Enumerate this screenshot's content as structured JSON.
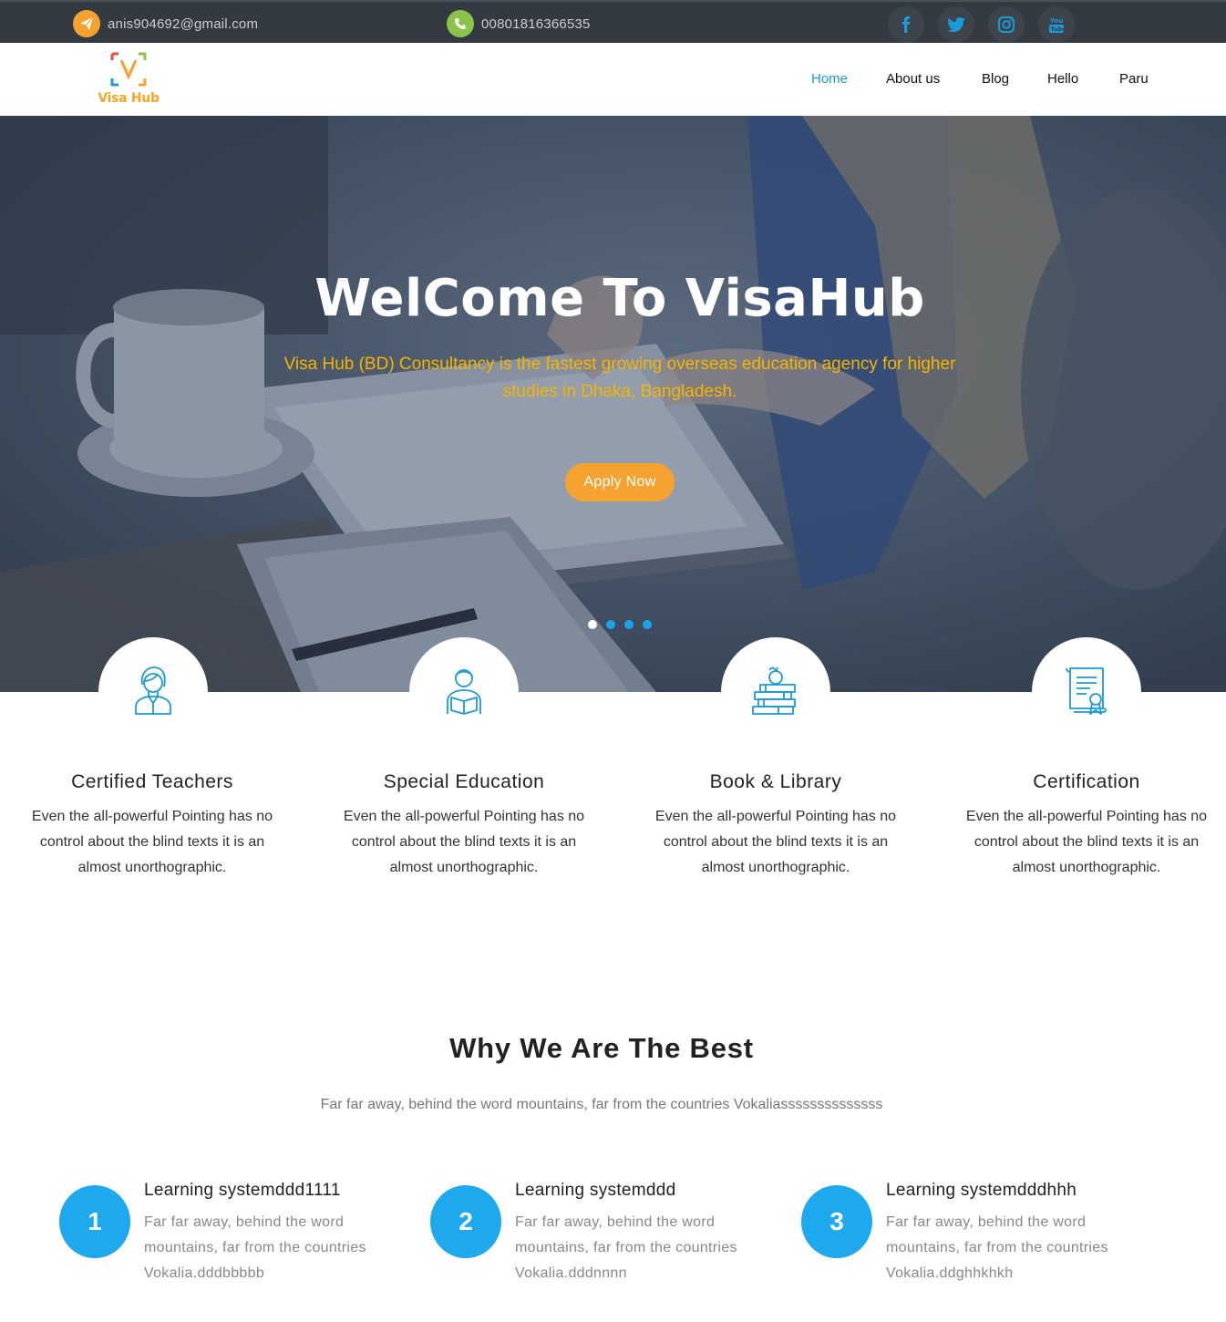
{
  "topbar": {
    "email": "anis904692@gmail.com",
    "phone": "00801816366535",
    "email_icon": "paper-plane-icon",
    "phone_icon": "phone-icon",
    "email_icon_color": "#f5a230",
    "phone_icon_color": "#8bc34a",
    "social": [
      "facebook-icon",
      "twitter-icon",
      "instagram-icon",
      "youtube-icon"
    ],
    "social_color": "#1a9bd7"
  },
  "logo": {
    "letter": "V",
    "text": "Visa Hub"
  },
  "nav": {
    "items": [
      {
        "label": "Home",
        "active": true
      },
      {
        "label": "About us",
        "active": false
      },
      {
        "label": "Blog",
        "active": false
      },
      {
        "label": "Hello",
        "active": false
      },
      {
        "label": "Paru",
        "active": false
      }
    ]
  },
  "hero": {
    "title": "WelCome To VisaHub",
    "subtitle": "Visa Hub (BD) Consultancy is the fastest growing overseas education agency for higher studies in Dhaka, Bangladesh.",
    "button": "Apply Now",
    "slides": 4,
    "active_slide": 1
  },
  "features": [
    {
      "icon": "teacher-icon",
      "title": "Certified Teachers",
      "text": "Even the all-powerful Pointing has no control about the blind texts it is an almost unorthographic."
    },
    {
      "icon": "student-reading-icon",
      "title": "Special Education",
      "text": "Even the all-powerful Pointing has no control about the blind texts it is an almost unorthographic."
    },
    {
      "icon": "books-apple-icon",
      "title": "Book & Library",
      "text": "Even the all-powerful Pointing has no control about the blind texts it is an almost unorthographic."
    },
    {
      "icon": "certificate-icon",
      "title": "Certification",
      "text": "Even the all-powerful Pointing has no control about the blind texts it is an almost unorthographic."
    }
  ],
  "why": {
    "title": "Why We Are The Best",
    "subtitle": "Far far away, behind the word mountains, far from the countries Vokaliassssssssssssss",
    "steps": [
      {
        "number": "1",
        "title": "Learning systemddd1111",
        "text": "Far far away, behind the word mountains, far from the countries Vokalia.dddbbbbb"
      },
      {
        "number": "2",
        "title": "Learning systemddd",
        "text": "Far far away, behind the word mountains, far from the countries Vokalia.dddnnnn"
      },
      {
        "number": "3",
        "title": "Learning systemdddhhh",
        "text": "Far far away, behind the word mountains, far from the countries Vokalia.ddghhkhkh"
      }
    ]
  },
  "colors": {
    "accent": "#1a9bd7",
    "orange": "#f5a230",
    "hero_text": "#f4b400",
    "topbar_bg": "#333a42"
  }
}
